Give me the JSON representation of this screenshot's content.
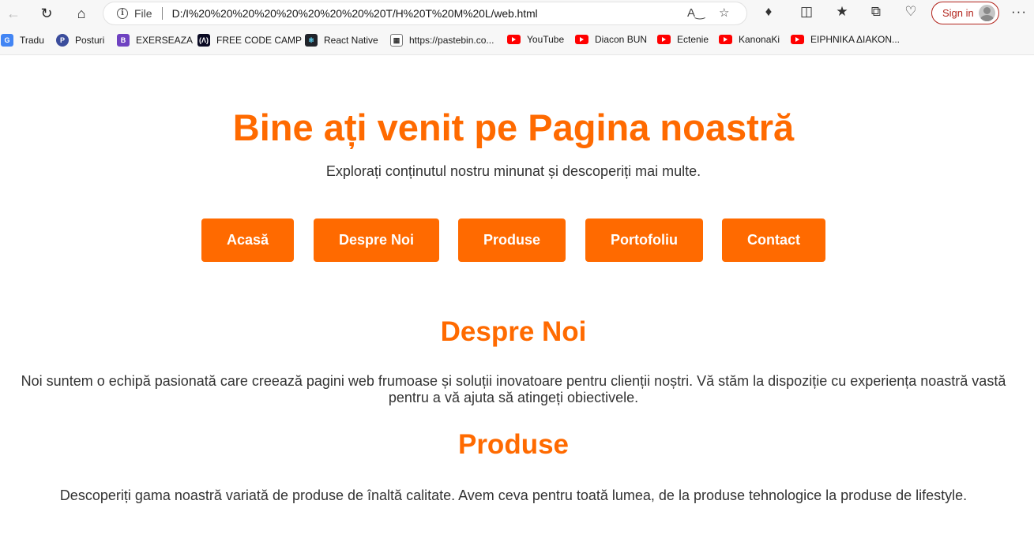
{
  "browser": {
    "address": {
      "scheme_label": "File",
      "url": "D:/I%20%20%20%20%20%20%20%20%20T/H%20T%20M%20L/web.html"
    },
    "signin_label": "Sign in",
    "bookmarks": [
      {
        "label": "Tradu",
        "icon": "google-translate-icon"
      },
      {
        "label": "Posturi",
        "icon": "posturi-icon"
      },
      {
        "label": "EXERSEAZA",
        "icon": "bootstrap-icon"
      },
      {
        "label": "FREE CODE CAMP",
        "icon": "freecodecamp-icon"
      },
      {
        "label": "React Native",
        "icon": "react-icon"
      },
      {
        "label": "https://pastebin.co...",
        "icon": "pastebin-icon"
      },
      {
        "label": "YouTube",
        "icon": "youtube-icon"
      },
      {
        "label": "Diacon BUN",
        "icon": "youtube-icon"
      },
      {
        "label": "Ectenie",
        "icon": "youtube-icon"
      },
      {
        "label": "KanonaKi",
        "icon": "youtube-icon"
      },
      {
        "label": "ΕΙΡΗΝΙΚΑ ΔΙΑΚΟΝ...",
        "icon": "youtube-icon"
      }
    ]
  },
  "page": {
    "accent_color": "#ff6a00",
    "hero": {
      "title": "Bine ați venit pe Pagina noastră",
      "subtitle": "Explorați conținutul nostru minunat și descoperiți mai multe."
    },
    "nav": [
      "Acasă",
      "Despre Noi",
      "Produse",
      "Portofoliu",
      "Contact"
    ],
    "sections": [
      {
        "title": "Despre Noi",
        "text": "Noi suntem o echipă pasionată care creează pagini web frumoase și soluții inovatoare pentru clienții noștri. Vă stăm la dispoziție cu experiența noastră vastă pentru a vă ajuta să atingeți obiectivele."
      },
      {
        "title": "Produse",
        "text": "Descoperiți gama noastră variată de produse de înaltă calitate. Avem ceva pentru toată lumea, de la produse tehnologice la produse de lifestyle."
      }
    ]
  }
}
